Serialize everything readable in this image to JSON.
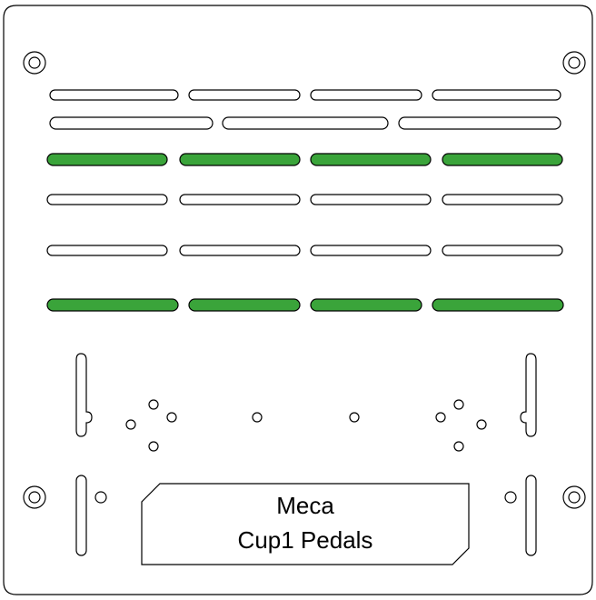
{
  "plate": {
    "label_lines": [
      "Meca",
      "Cup1 Pedals"
    ]
  },
  "colors": {
    "outline": "#000000",
    "background": "#ffffff",
    "highlight_slot": "#3aa43a"
  }
}
